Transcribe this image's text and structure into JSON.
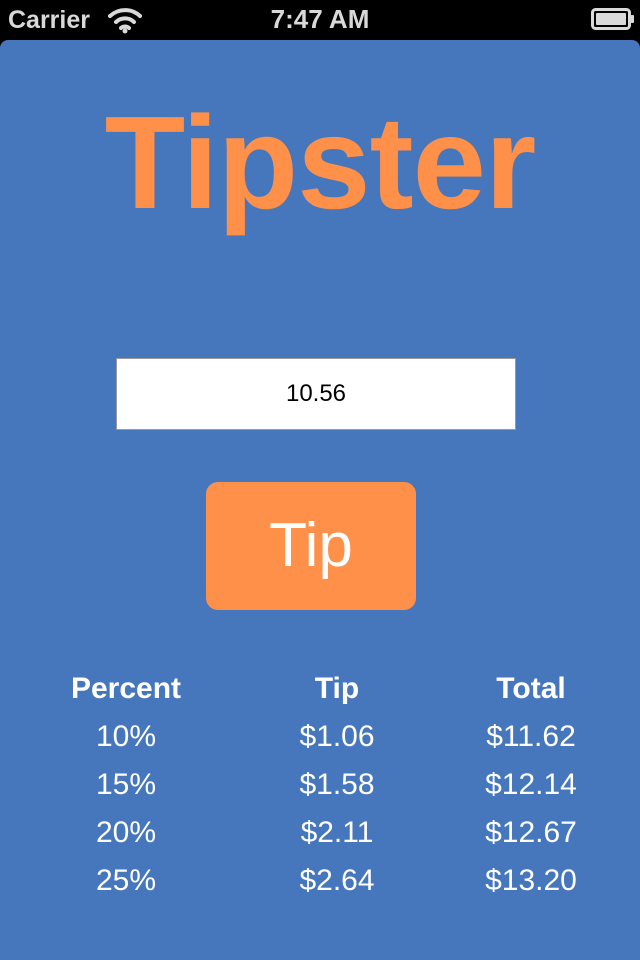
{
  "status_bar": {
    "carrier": "Carrier",
    "time": "7:47 AM",
    "wifi_icon": "wifi-icon",
    "battery_icon": "battery-icon"
  },
  "app": {
    "title": "Tipster",
    "amount_value": "10.56",
    "tip_button_label": "Tip"
  },
  "results": {
    "headers": [
      "Percent",
      "Tip",
      "Total"
    ],
    "rows": [
      [
        "10%",
        "$1.06",
        "$11.62"
      ],
      [
        "15%",
        "$1.58",
        "$12.14"
      ],
      [
        "20%",
        "$2.11",
        "$12.67"
      ],
      [
        "25%",
        "$2.64",
        "$13.20"
      ]
    ]
  },
  "colors": {
    "background": "#4677bd",
    "accent": "#ff904a",
    "text": "#ffffff"
  }
}
